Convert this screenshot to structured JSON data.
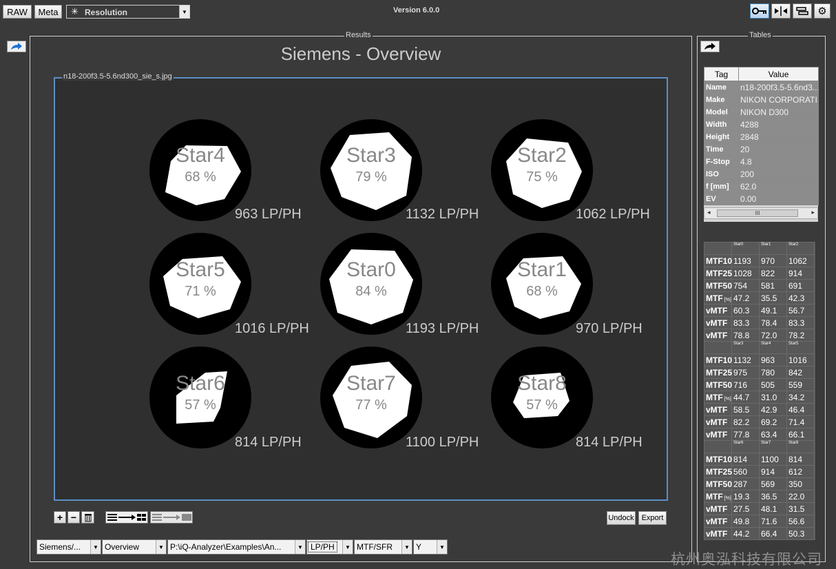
{
  "toolbar": {
    "raw_label": "RAW",
    "meta_label": "Meta",
    "module_value": "Resolution",
    "version": "Version 6.0.0"
  },
  "results": {
    "legend": "Results",
    "title": "Siemens - Overview",
    "image_name": "n18-200f3.5-5.6nd300_sie_s.jpg",
    "stars": [
      {
        "name": "Star4",
        "pct": "68 %",
        "lp": "963 LP/PH"
      },
      {
        "name": "Star3",
        "pct": "79 %",
        "lp": "1132 LP/PH"
      },
      {
        "name": "Star2",
        "pct": "75 %",
        "lp": "1062 LP/PH"
      },
      {
        "name": "Star5",
        "pct": "71 %",
        "lp": "1016 LP/PH"
      },
      {
        "name": "Star0",
        "pct": "84 %",
        "lp": "1193 LP/PH"
      },
      {
        "name": "Star1",
        "pct": "68 %",
        "lp": "970 LP/PH"
      },
      {
        "name": "Star6",
        "pct": "57 %",
        "lp": "814 LP/PH"
      },
      {
        "name": "Star7",
        "pct": "77 %",
        "lp": "1100 LP/PH"
      },
      {
        "name": "Star8",
        "pct": "57 %",
        "lp": "814 LP/PH"
      }
    ],
    "undock_label": "Undock",
    "export_label": "Export"
  },
  "bottom_bar": {
    "dd1": "Siemens/...",
    "dd2": "Overview",
    "dd3": "P:\\iQ-Analyzer\\Examples\\An...",
    "dd4": "LP/PH",
    "dd5": "MTF/SFR",
    "dd6": "Y"
  },
  "tables": {
    "legend": "Tables",
    "meta_headers": {
      "tag": "Tag",
      "value": "Value"
    },
    "meta_rows": [
      {
        "tag": "Name",
        "value": "n18-200f3.5-5.6nd3..."
      },
      {
        "tag": "Make",
        "value": "NIKON CORPORATI..."
      },
      {
        "tag": "Model",
        "value": "NIKON D300"
      },
      {
        "tag": "Width",
        "value": "4288"
      },
      {
        "tag": "Height",
        "value": "2848"
      },
      {
        "tag": "Time",
        "value": "20"
      },
      {
        "tag": "F-Stop",
        "value": "4.8"
      },
      {
        "tag": "ISO",
        "value": "200"
      },
      {
        "tag": "f [mm]",
        "value": "62.0"
      },
      {
        "tag": "EV",
        "value": "0.00"
      }
    ],
    "scroll_grip": "III",
    "mtf_groups": [
      {
        "headers": [
          "Star0",
          "Star1",
          "Star2"
        ],
        "rows": [
          {
            "label": "MTF10",
            "values": [
              "1193",
              "970",
              "1062"
            ]
          },
          {
            "label": "MTF25",
            "values": [
              "1028",
              "822",
              "914"
            ]
          },
          {
            "label": "MTF50",
            "values": [
              "754",
              "581",
              "691"
            ]
          },
          {
            "label": "MTF",
            "sub": "[%]",
            "values": [
              "47.2",
              "35.5",
              "42.3"
            ]
          },
          {
            "label": "vMTF",
            "values": [
              "60.3",
              "49.1",
              "56.7"
            ]
          },
          {
            "label": "vMTF",
            "values": [
              "83.3",
              "78.4",
              "83.3"
            ]
          },
          {
            "label": "vMTF",
            "values": [
              "78.8",
              "72.0",
              "78.2"
            ]
          }
        ]
      },
      {
        "headers": [
          "Star3",
          "Star4",
          "Star5"
        ],
        "rows": [
          {
            "label": "MTF10",
            "values": [
              "1132",
              "963",
              "1016"
            ]
          },
          {
            "label": "MTF25",
            "values": [
              "975",
              "780",
              "842"
            ]
          },
          {
            "label": "MTF50",
            "values": [
              "716",
              "505",
              "559"
            ]
          },
          {
            "label": "MTF",
            "sub": "[%]",
            "values": [
              "44.7",
              "31.0",
              "34.2"
            ]
          },
          {
            "label": "vMTF",
            "values": [
              "58.5",
              "42.9",
              "46.4"
            ]
          },
          {
            "label": "vMTF",
            "values": [
              "82.2",
              "69.2",
              "71.4"
            ]
          },
          {
            "label": "vMTF",
            "values": [
              "77.8",
              "63.4",
              "66.1"
            ]
          }
        ]
      },
      {
        "headers": [
          "Star6",
          "Star7",
          "Star8"
        ],
        "rows": [
          {
            "label": "MTF10",
            "values": [
              "814",
              "1100",
              "814"
            ]
          },
          {
            "label": "MTF25",
            "values": [
              "560",
              "914",
              "612"
            ]
          },
          {
            "label": "MTF50",
            "values": [
              "287",
              "569",
              "350"
            ]
          },
          {
            "label": "MTF",
            "sub": "[%]",
            "values": [
              "19.3",
              "36.5",
              "22.0"
            ]
          },
          {
            "label": "vMTF",
            "values": [
              "27.5",
              "48.1",
              "31.5"
            ]
          },
          {
            "label": "vMTF",
            "values": [
              "49.8",
              "71.6",
              "56.6"
            ]
          },
          {
            "label": "vMTF",
            "values": [
              "44.2",
              "66.4",
              "50.3"
            ]
          }
        ]
      }
    ]
  },
  "watermark": "杭州奥泓科技有限公司"
}
